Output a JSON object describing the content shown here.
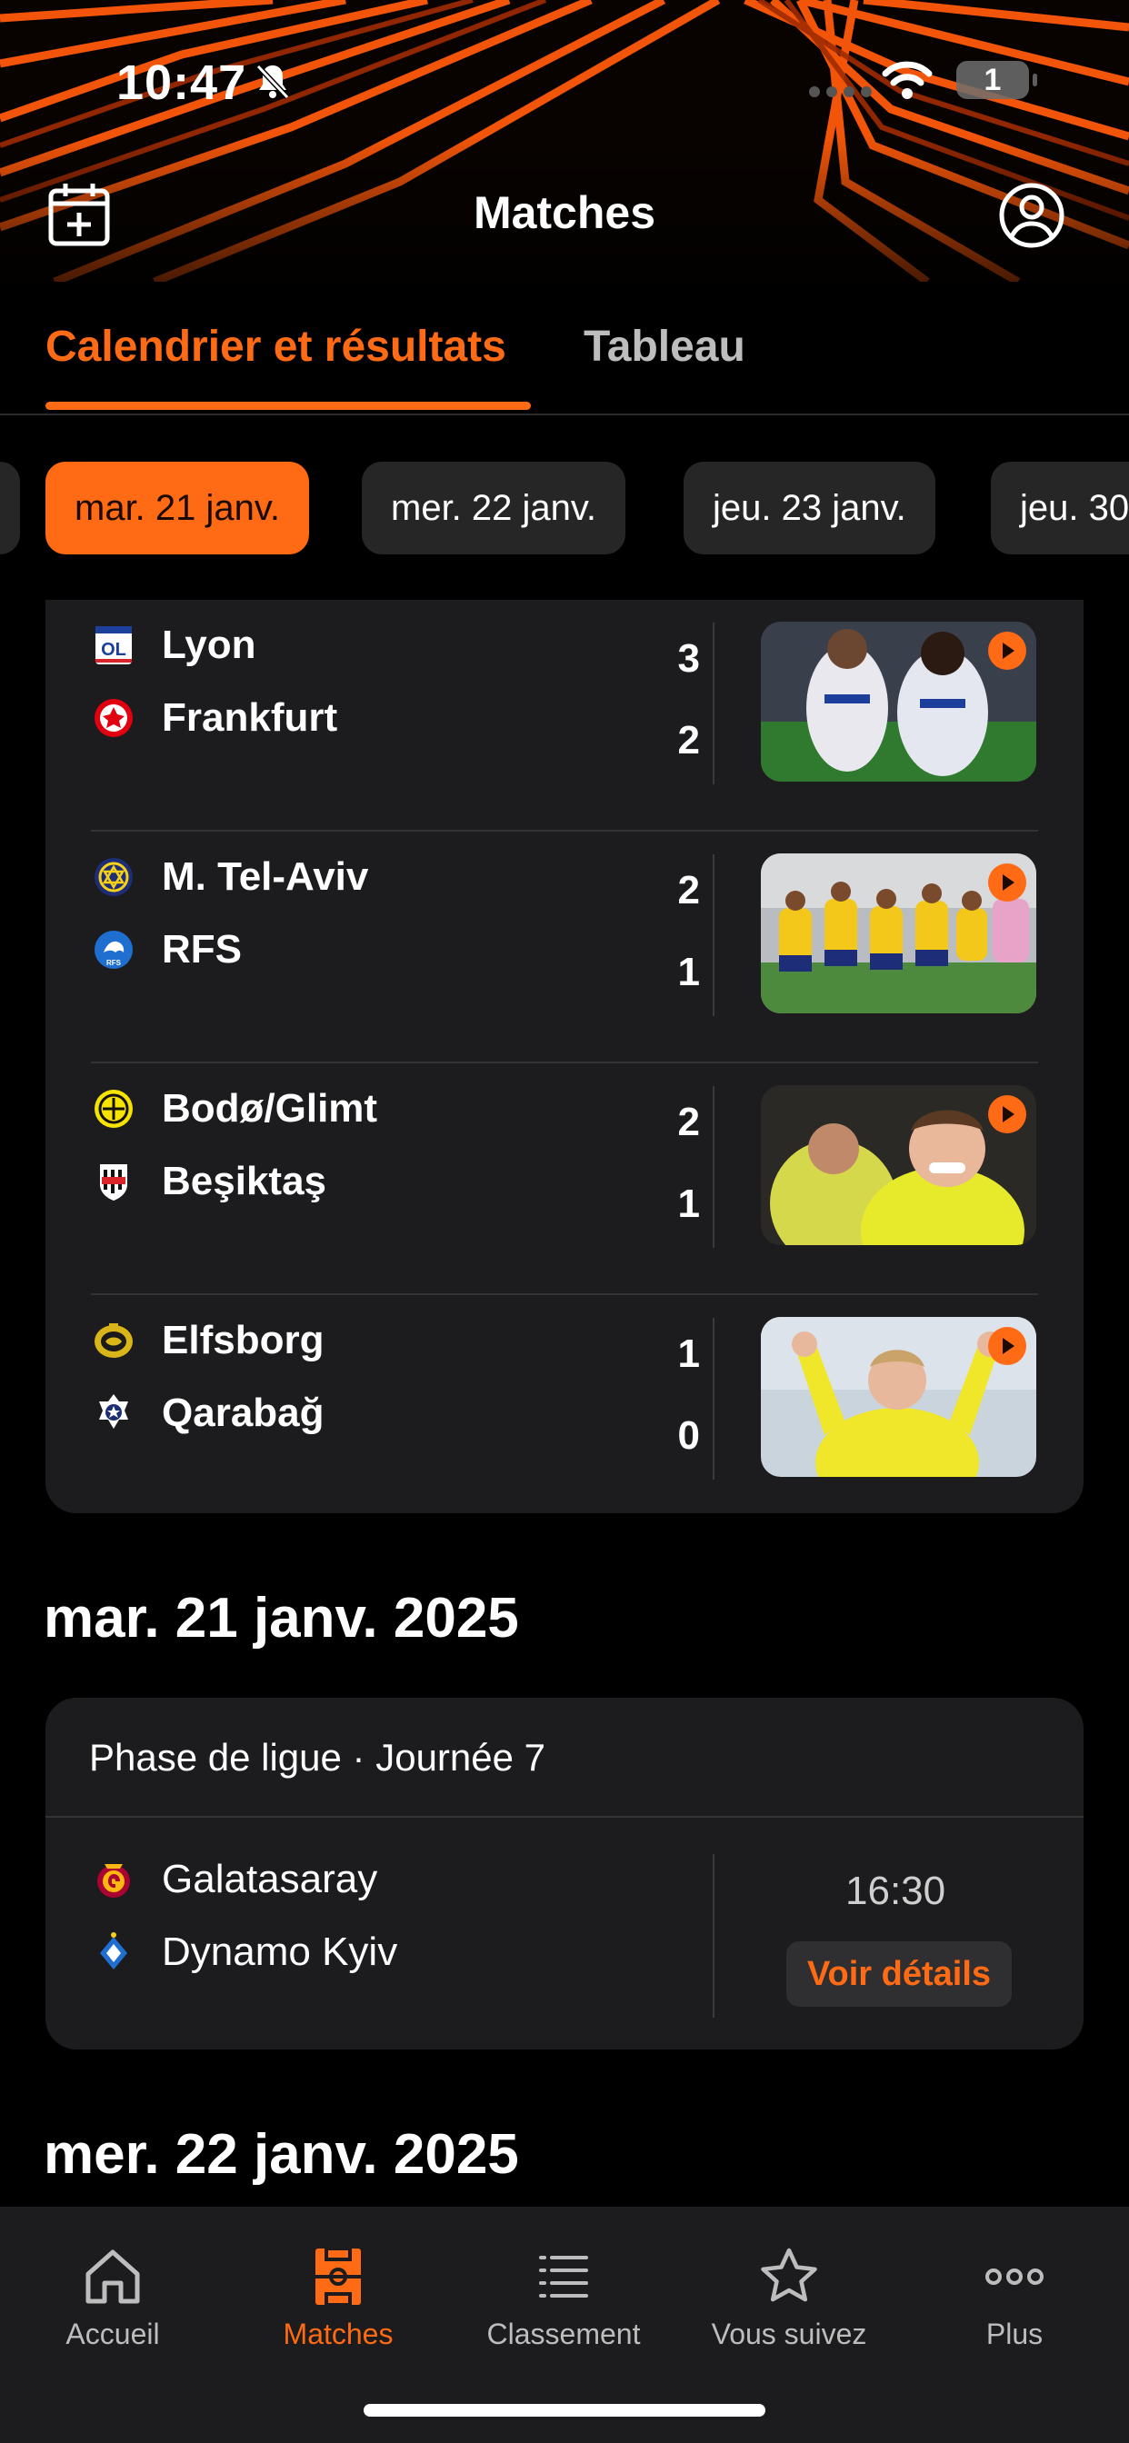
{
  "status_bar": {
    "time": "10:47",
    "battery": "1"
  },
  "header": {
    "title": "Matches"
  },
  "tabs": [
    {
      "label": "Calendrier et résultats",
      "active": true
    },
    {
      "label": "Tableau",
      "active": false
    }
  ],
  "date_chips": [
    {
      "label": "mar. 21 janv.",
      "active": true
    },
    {
      "label": "mer. 22 janv.",
      "active": false
    },
    {
      "label": "jeu. 23 janv.",
      "active": false
    },
    {
      "label": "jeu. 30 janv.",
      "active": false
    }
  ],
  "results": [
    {
      "home": "Lyon",
      "away": "Frankfurt",
      "home_score": "3",
      "away_score": "2"
    },
    {
      "home": "M. Tel-Aviv",
      "away": "RFS",
      "home_score": "2",
      "away_score": "1"
    },
    {
      "home": "Bodø/Glimt",
      "away": "Beşiktaş",
      "home_score": "2",
      "away_score": "1"
    },
    {
      "home": "Elfsborg",
      "away": "Qarabağ",
      "home_score": "1",
      "away_score": "0"
    }
  ],
  "day1": {
    "heading": "mar. 21 janv. 2025",
    "phase": "Phase de ligue · Journée 7",
    "fixture": {
      "home": "Galatasaray",
      "away": "Dynamo Kyiv",
      "time": "16:30",
      "details_label": "Voir détails"
    }
  },
  "day2": {
    "heading": "mer. 22 janv. 2025"
  },
  "bottom_nav": [
    {
      "label": "Accueil",
      "icon": "home-icon",
      "active": false
    },
    {
      "label": "Matches",
      "icon": "pitch-icon",
      "active": true
    },
    {
      "label": "Classement",
      "icon": "list-icon",
      "active": false
    },
    {
      "label": "Vous suivez",
      "icon": "star-icon",
      "active": false
    },
    {
      "label": "Plus",
      "icon": "more-icon",
      "active": false
    }
  ],
  "colors": {
    "accent": "#ff6a14",
    "card": "#1c1c1e",
    "background": "#000000"
  }
}
